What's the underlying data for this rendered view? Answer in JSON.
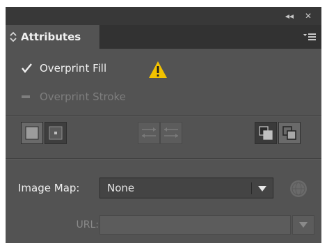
{
  "window": {
    "collapse_glyph": "◂◂",
    "close_glyph": "✕"
  },
  "tab": {
    "label": "Attributes",
    "updown_icon": "updown-chevron-icon",
    "menu_icon": "panel-menu-icon"
  },
  "options": {
    "overprint_fill": {
      "label": "Overprint Fill",
      "checked": true
    },
    "overprint_stroke": {
      "label": "Overprint Stroke",
      "checked": false,
      "disabled": true
    },
    "warning_icon": "warning-triangle-icon"
  },
  "image_map": {
    "label": "Image Map:",
    "value": "None"
  },
  "url": {
    "label": "URL:",
    "value": ""
  },
  "colors": {
    "panel_bg": "#535353",
    "titlebar_bg": "#383838",
    "warning": "#f2c200",
    "text": "#f0f0f0",
    "disabled_text": "#7e7e7e"
  }
}
